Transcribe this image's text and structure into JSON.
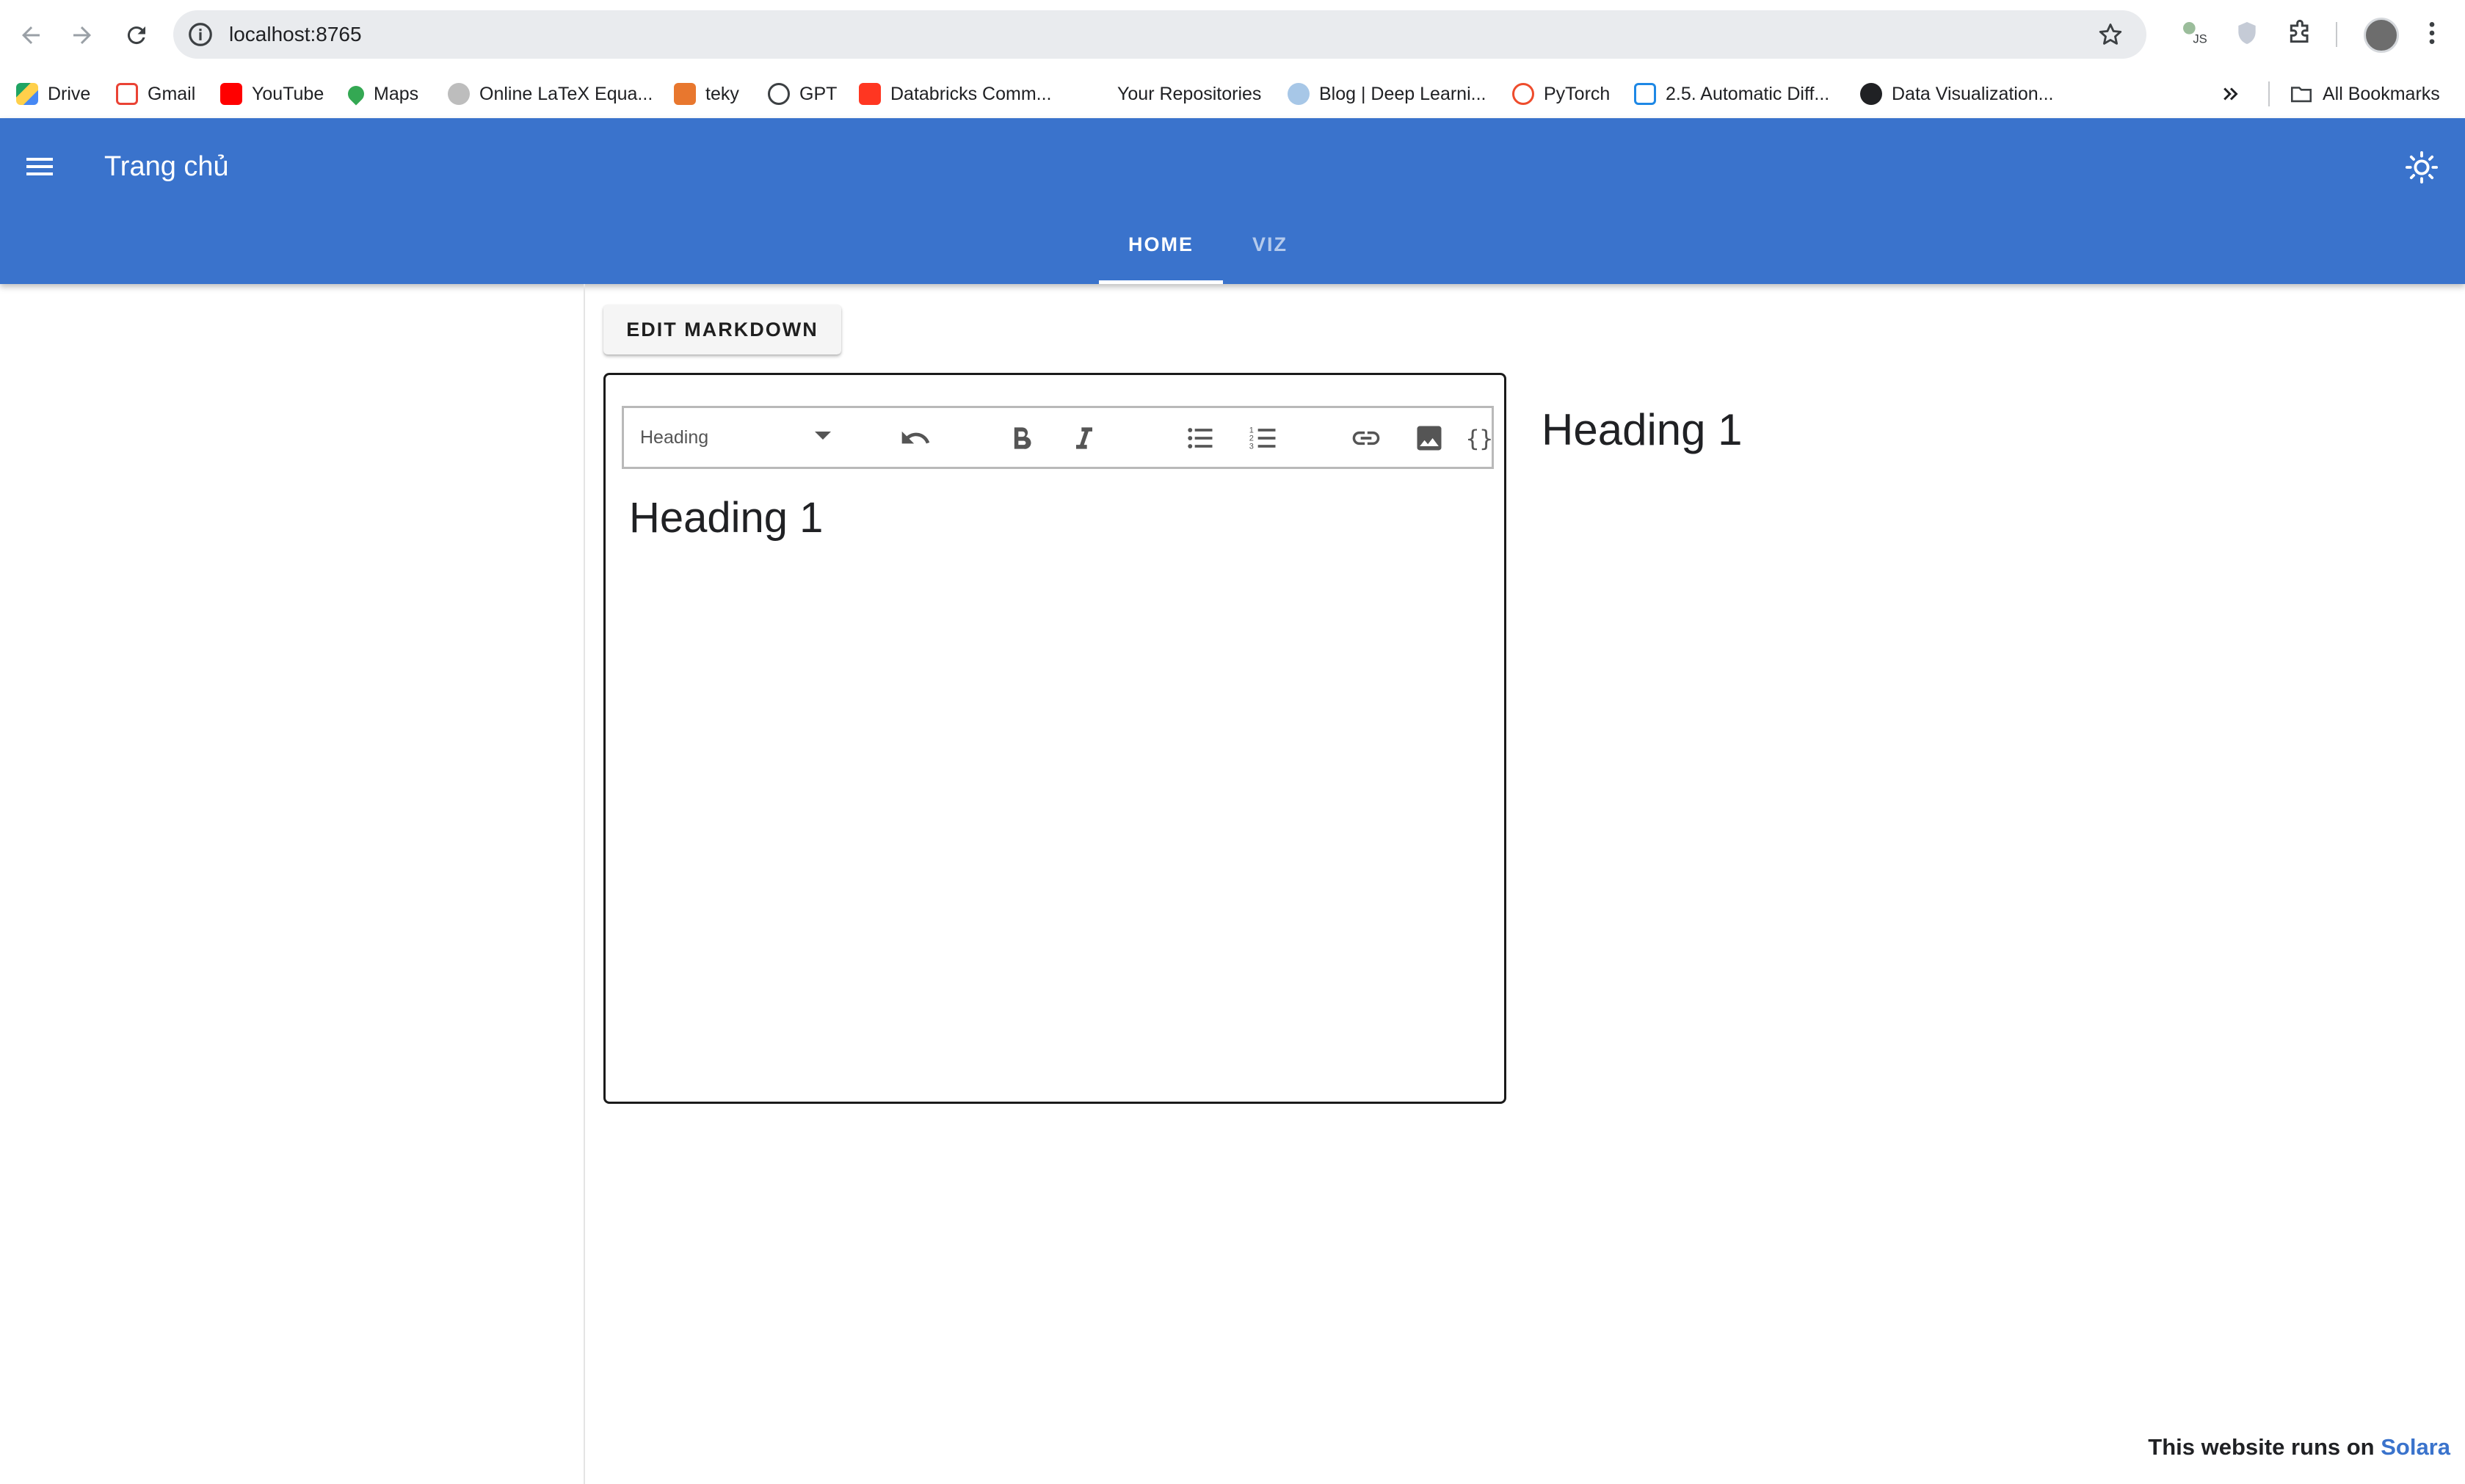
{
  "browser": {
    "url": "localhost:8765",
    "bookmarks": [
      {
        "label": "Drive",
        "icon": "drive-icon"
      },
      {
        "label": "Gmail",
        "icon": "gmail-icon"
      },
      {
        "label": "YouTube",
        "icon": "youtube-icon"
      },
      {
        "label": "Maps",
        "icon": "maps-icon"
      },
      {
        "label": "Online LaTeX Equa...",
        "icon": "gear-icon"
      },
      {
        "label": "teky",
        "icon": "teky-icon"
      },
      {
        "label": "GPT",
        "icon": "openai-icon"
      },
      {
        "label": "Databricks Comm...",
        "icon": "databricks-icon"
      },
      {
        "label": "Your Repositories",
        "icon": "blank-icon"
      },
      {
        "label": "Blog | Deep Learni...",
        "icon": "blog-icon"
      },
      {
        "label": "PyTorch",
        "icon": "pytorch-icon"
      },
      {
        "label": "2.5. Automatic Diff...",
        "icon": "d2l-icon"
      },
      {
        "label": "Data Visualization...",
        "icon": "globe-icon"
      }
    ],
    "all_bookmarks": "All Bookmarks"
  },
  "appbar": {
    "title": "Trang chủ",
    "tabs": [
      {
        "label": "HOME",
        "active": true
      },
      {
        "label": "VIZ",
        "active": false
      }
    ],
    "color": "#3a73cc"
  },
  "main": {
    "edit_button": "EDIT MARKDOWN",
    "editor": {
      "heading_select": "Heading",
      "content": "Heading 1"
    },
    "preview_heading": "Heading 1"
  },
  "footer": {
    "text": "This website runs on ",
    "link": "Solara"
  }
}
